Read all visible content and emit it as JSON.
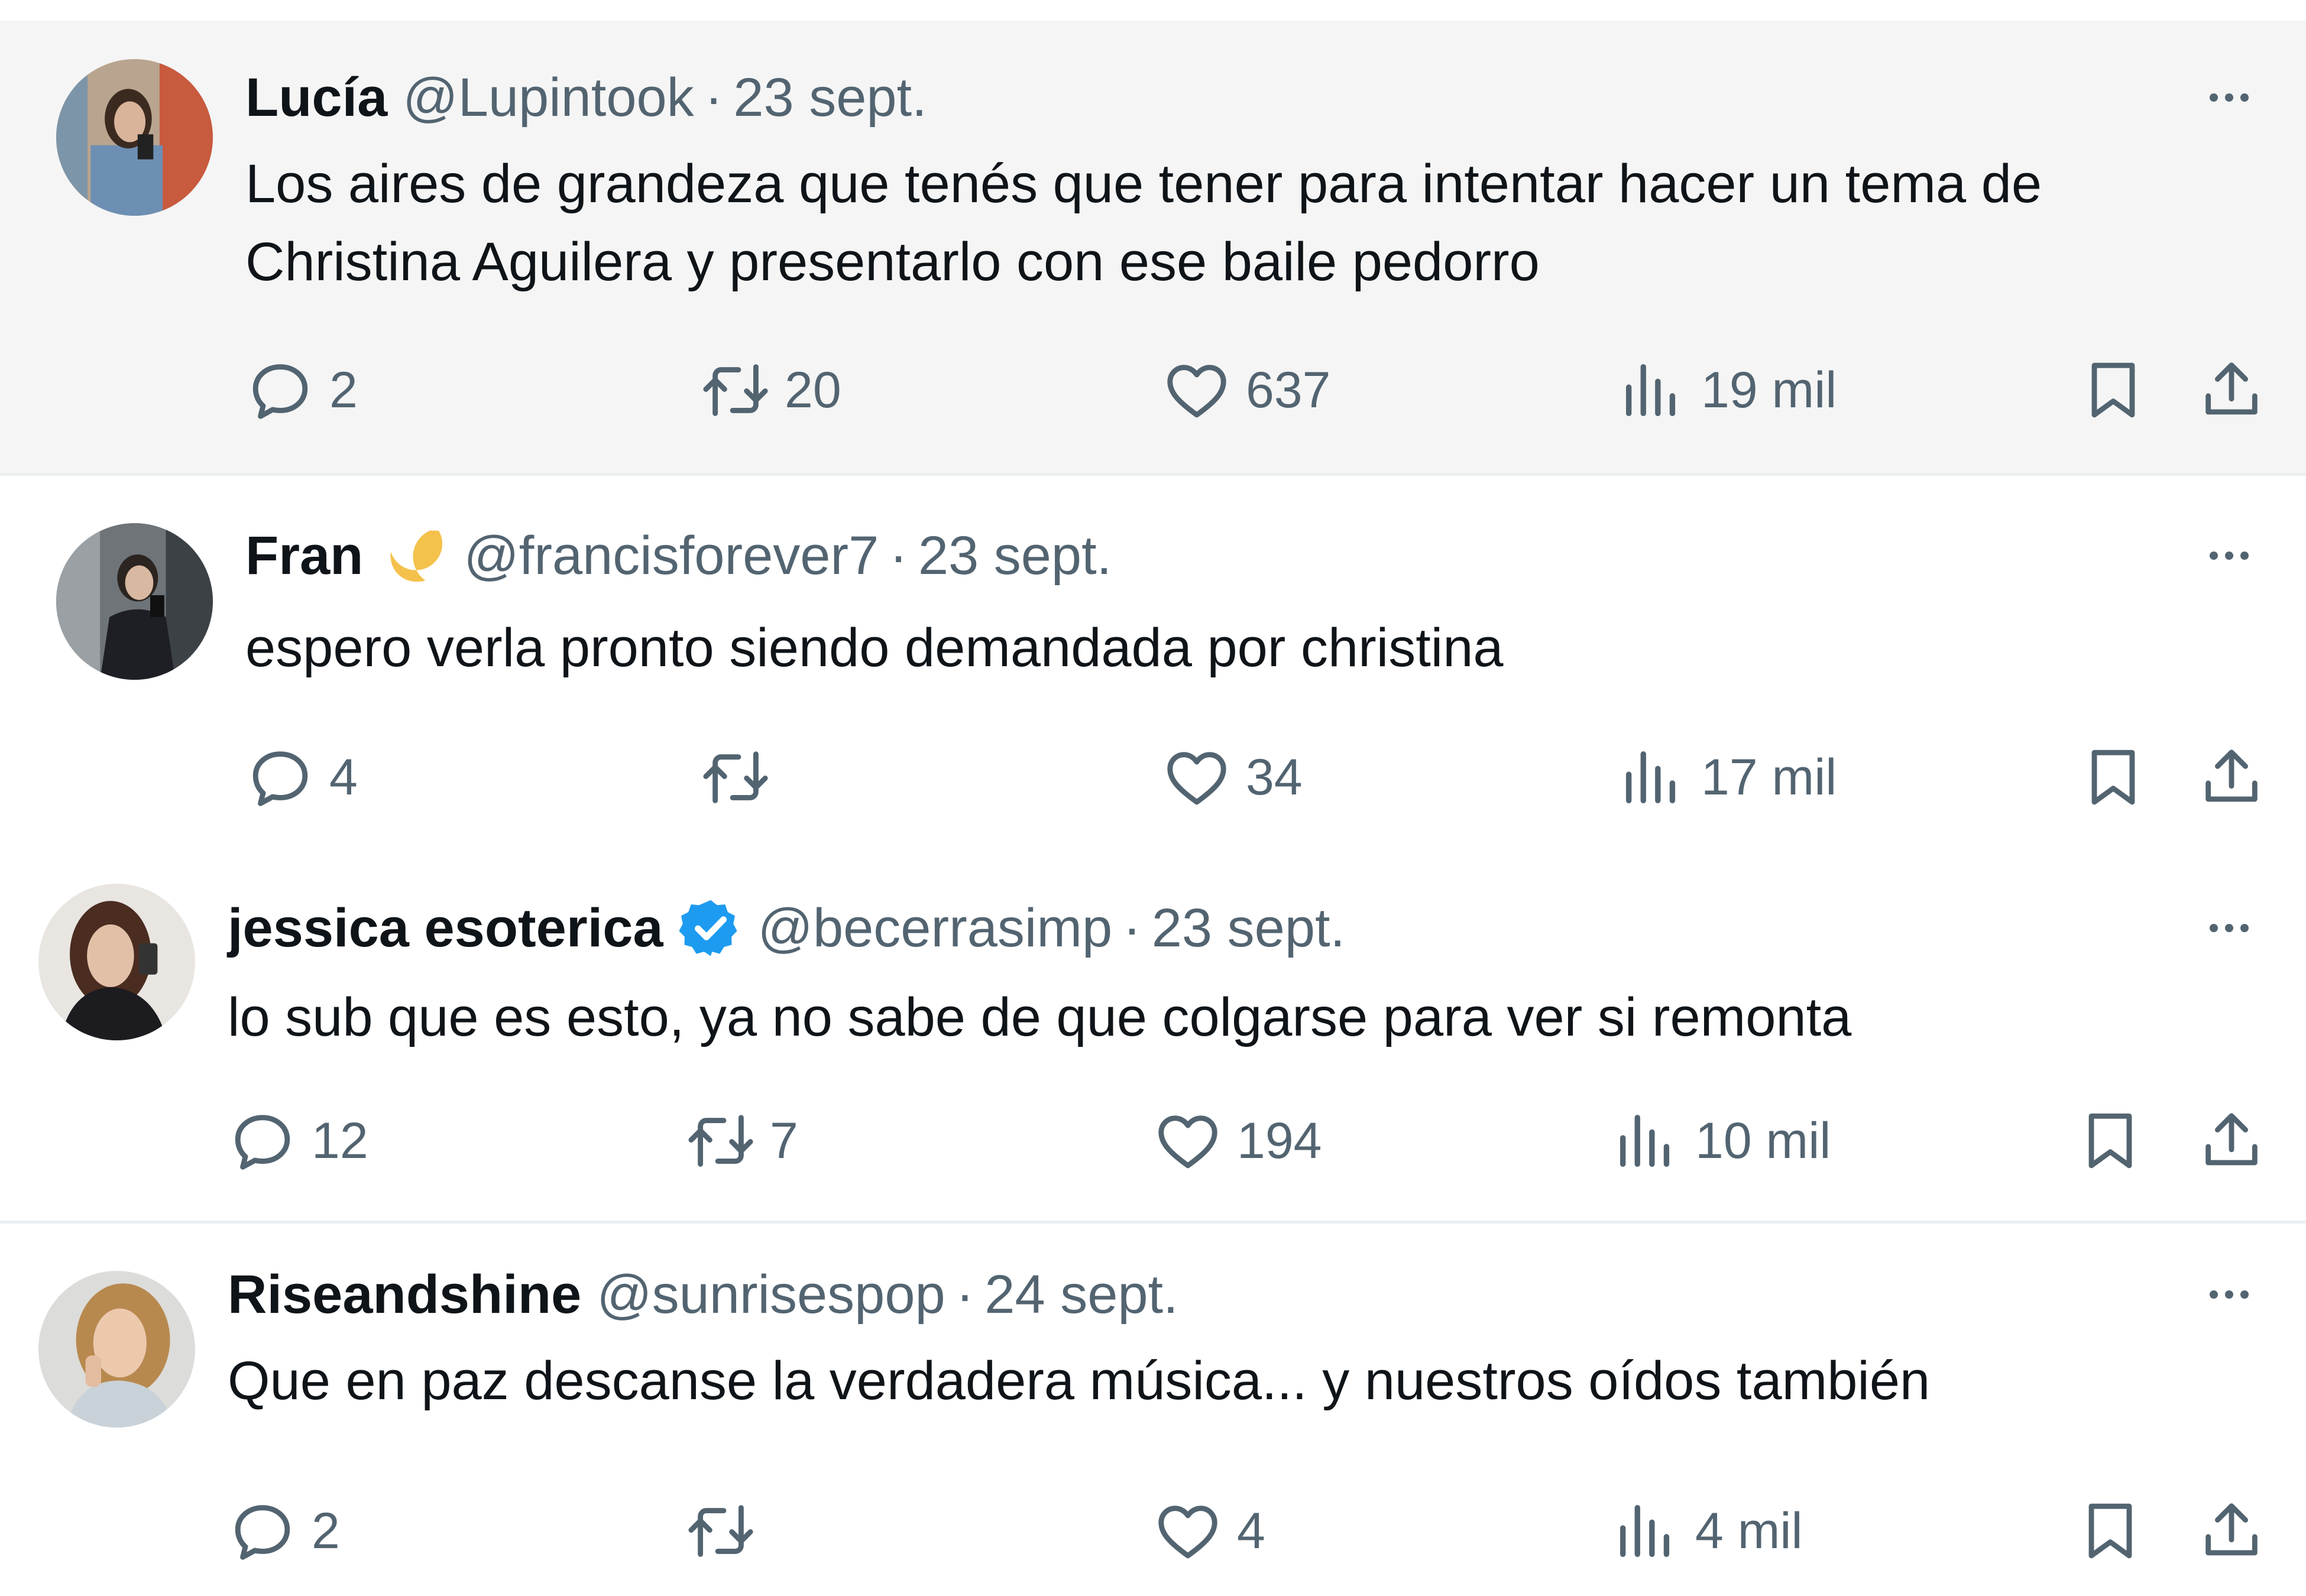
{
  "tweets": [
    {
      "name": "Lucía",
      "handle": "@Lupintook",
      "separator": "·",
      "date": "23 sept.",
      "text": "Los aires de grandeza que tenés que tener para intentar hacer un tema de\nChristina Aguilera y presentarlo con ese baile pedorro",
      "replies": "2",
      "retweets": "20",
      "likes": "637",
      "views": "19 mil",
      "emoji": "",
      "verified": false
    },
    {
      "name": "Fran",
      "handle": "@francisforever7",
      "separator": "·",
      "date": "23 sept.",
      "text": "espero verla pronto siendo demandada por christina",
      "replies": "4",
      "retweets": "",
      "likes": "34",
      "views": "17 mil",
      "emoji": "crescent-moon",
      "verified": false
    },
    {
      "name": "jessica esoterica",
      "handle": "@becerrasimp",
      "separator": "·",
      "date": "23 sept.",
      "text": "lo sub que es esto, ya no sabe de que colgarse para ver si remonta",
      "replies": "12",
      "retweets": "7",
      "likes": "194",
      "views": "10 mil",
      "emoji": "",
      "verified": true
    },
    {
      "name": "Riseandshine",
      "handle": "@sunrisespop",
      "separator": "·",
      "date": "24 sept.",
      "text": "Que en paz descanse la verdadera música... y nuestros oídos también",
      "replies": "2",
      "retweets": "",
      "likes": "4",
      "views": "4 mil",
      "emoji": "",
      "verified": false
    }
  ],
  "icons": {
    "reply": "reply-icon",
    "retweet": "retweet-icon",
    "like": "heart-icon",
    "views": "views-chart-icon",
    "bookmark": "bookmark-icon",
    "share": "share-icon",
    "more": "more-options-icon",
    "verified": "verified-badge-icon"
  },
  "colors": {
    "text": "#0f1419",
    "secondary": "#536471",
    "highlight_bg": "#f5f5f5",
    "verified_blue": "#1d9bf0",
    "divider": "#eceff1"
  }
}
